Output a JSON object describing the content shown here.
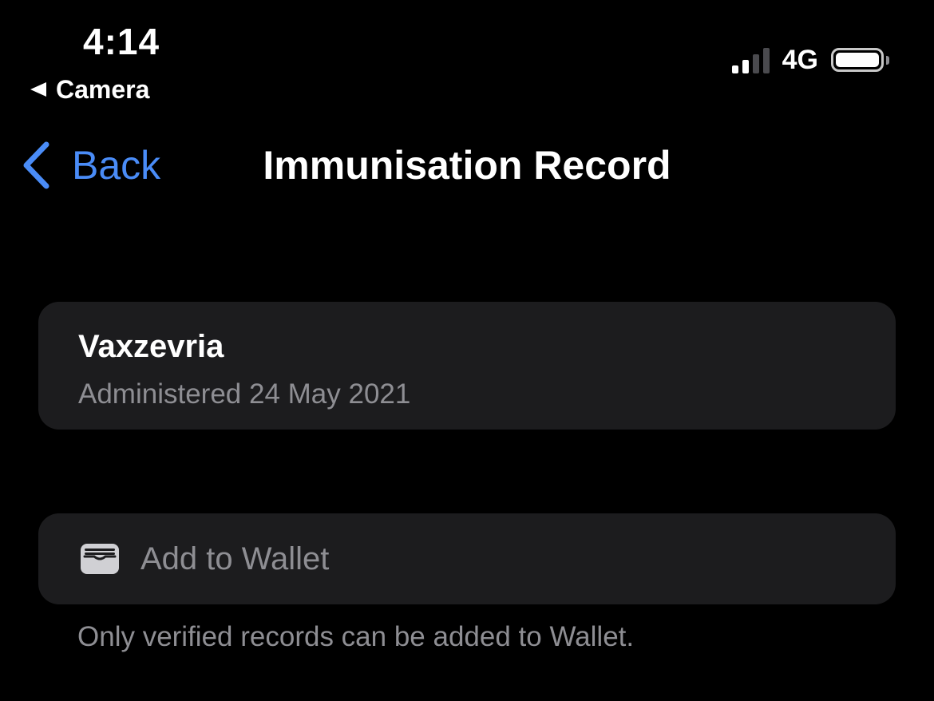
{
  "status_bar": {
    "time": "4:14",
    "return_app": "Camera",
    "network": "4G",
    "signal_bars": 2,
    "signal_bars_total": 4,
    "battery_level": 1.0
  },
  "navigation": {
    "back_label": "Back",
    "title": "Immunisation Record"
  },
  "record": {
    "vaccine": "Vaxzevria",
    "administered": "Administered 24 May 2021"
  },
  "wallet": {
    "button_label": "Add to Wallet",
    "icon": "wallet-icon",
    "footnote": "Only verified records can be added to Wallet."
  },
  "colors": {
    "background": "#000000",
    "card": "#1c1c1e",
    "accent": "#4a8cf7",
    "secondary_text": "#8e8e93",
    "primary_text": "#ffffff"
  }
}
